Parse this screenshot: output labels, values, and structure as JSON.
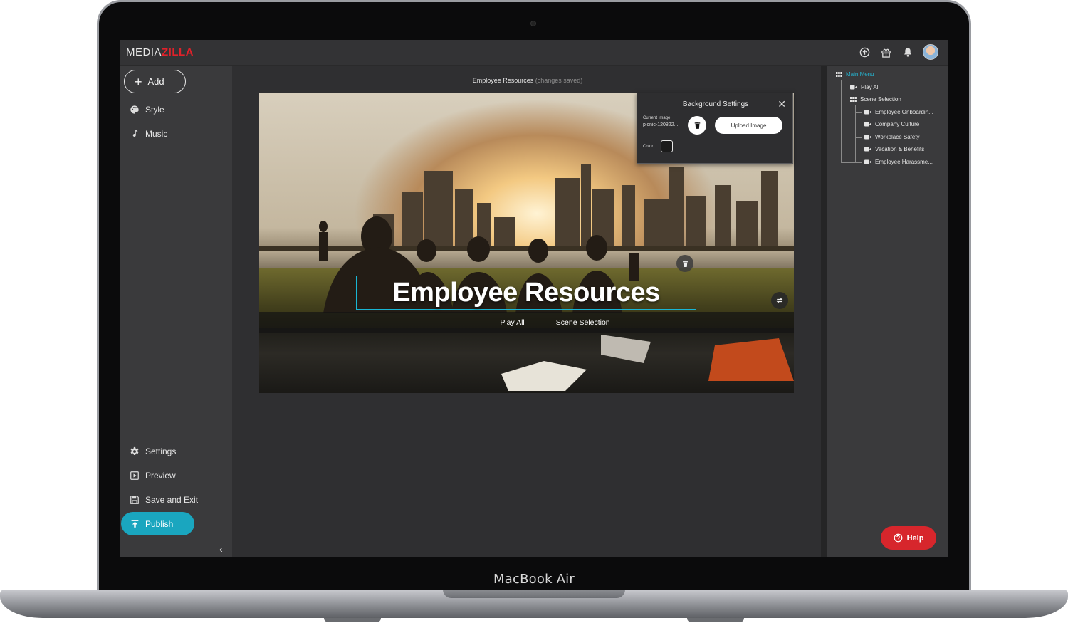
{
  "device": {
    "label": "MacBook Air"
  },
  "app": {
    "logo_part1": "MEDIA",
    "logo_part2": "ZILLA",
    "brand_color": "#e0212a",
    "accent_color": "#1aa6bf",
    "top_icons": [
      "upload-circle-icon",
      "gift-icon",
      "bell-icon",
      "avatar"
    ]
  },
  "sidebar": {
    "add_label": "Add",
    "items": [
      {
        "label": "Style",
        "icon": "palette-icon"
      },
      {
        "label": "Music",
        "icon": "music-note-icon"
      }
    ],
    "bottom_items": [
      {
        "label": "Settings",
        "icon": "gear-icon"
      },
      {
        "label": "Preview",
        "icon": "play-square-icon"
      },
      {
        "label": "Save and Exit",
        "icon": "floppy-disk-icon"
      }
    ],
    "publish_label": "Publish"
  },
  "canvas": {
    "project_title": "Employee Resources",
    "save_status": "(changes saved)",
    "menu_title": "Employee Resources",
    "menu_buttons": [
      "Play All",
      "Scene Selection"
    ]
  },
  "bg_settings": {
    "title": "Background Settings",
    "current_image_label": "Current Image",
    "current_image_file": "picnic-120822...",
    "upload_label": "Upload Image",
    "color_label": "Color"
  },
  "tree": {
    "main_menu": "Main Menu",
    "play_all": "Play All",
    "scene_selection": "Scene Selection",
    "scenes": [
      "Employee Onboardin...",
      "Company Culture",
      "Workplace Safety",
      "Vacation & Benefits",
      "Employee Harassme..."
    ]
  },
  "help": {
    "label": "Help"
  }
}
